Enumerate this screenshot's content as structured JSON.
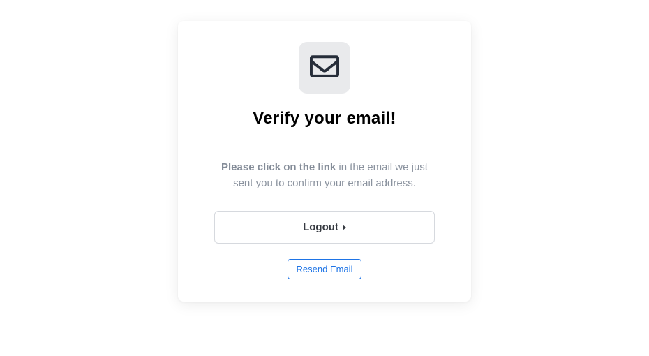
{
  "card": {
    "icon_name": "envelope-icon",
    "title": "Verify your email!",
    "message_bold": "Please click on the link",
    "message_rest": " in the email we just sent you to confirm your email address.",
    "logout_label": "Logout",
    "resend_label": "Resend Email"
  }
}
